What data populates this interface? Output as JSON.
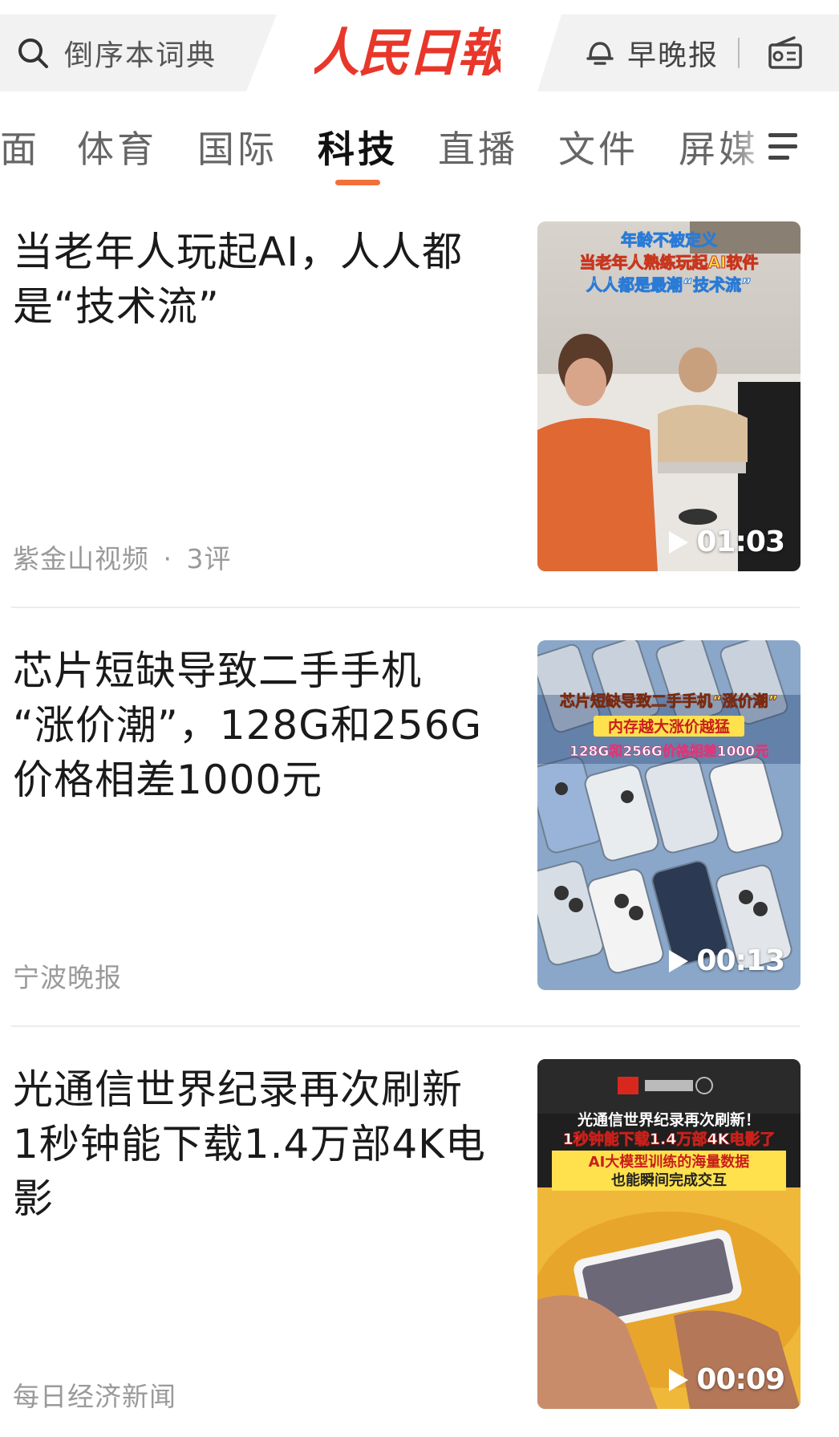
{
  "header": {
    "search_placeholder": "倒序本词典",
    "brand": "人民日報",
    "morning_evening": "早晚报"
  },
  "tabs": [
    "面",
    "体育",
    "国际",
    "科技",
    "直播",
    "文件",
    "屏媒"
  ],
  "active_tab": "科技",
  "articles": [
    {
      "title_line1": "当老年人玩起AI，人人都",
      "title_line2": "是“技术流”",
      "source": "紫金山视频",
      "comments": "3评",
      "duration": "01:03",
      "thumb_lines": [
        "年龄不被定义",
        "当老年人熟练玩起AI软件",
        "人人都是最潮“技术流”"
      ]
    },
    {
      "title_line1": "芯片短缺导致二手手机",
      "title_line2": "“涨价潮”，128G和256G",
      "title_line3": "价格相差1000元",
      "source": "宁波晚报",
      "duration": "00:13",
      "thumb_lines": [
        "芯片短缺导致二手手机“涨价潮”",
        "内存越大涨价越猛",
        "128G和256G价格相差1000元"
      ]
    },
    {
      "title_line1": "光通信世界纪录再次刷新",
      "title_line2": "1秒钟能下载1.4万部4K电",
      "title_line3": "影",
      "source": "每日经济新闻",
      "duration": "00:09",
      "thumb_lines": [
        "光通信世界纪录再次刷新！",
        "1秒钟能下载1.4万部4K电影了",
        "AI大模型训练的海量数据",
        "也能瞬间完成交互"
      ]
    }
  ],
  "colors": {
    "accent": "#e8372a",
    "tab_underline": "#f2703a",
    "meta": "#9a9a9a"
  }
}
